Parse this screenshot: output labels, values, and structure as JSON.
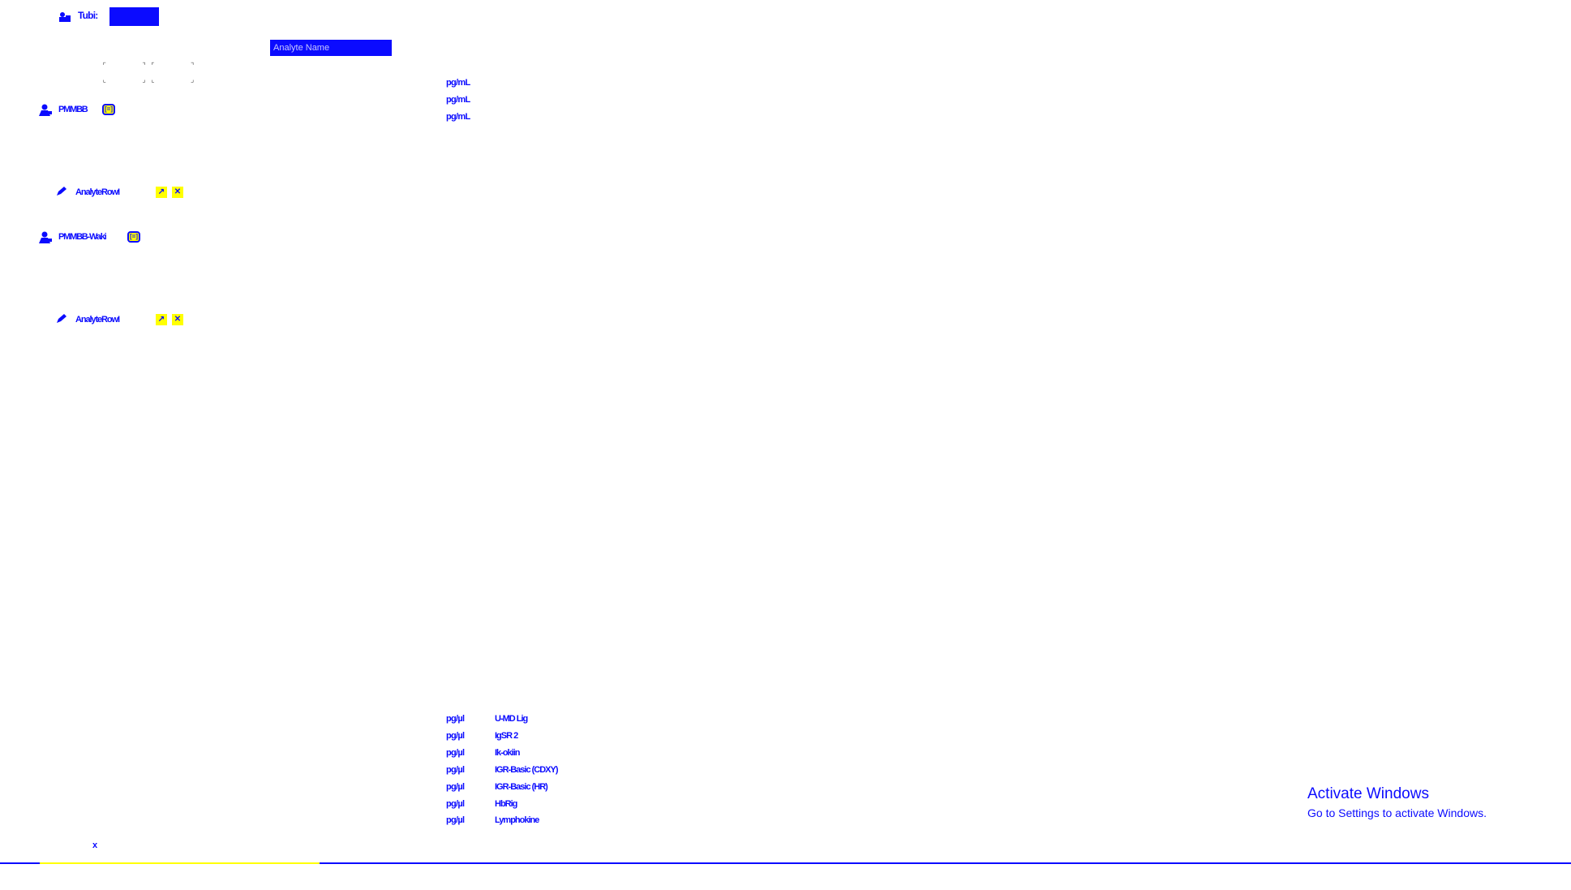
{
  "header": {
    "user_icon": "users-icon",
    "label": "Tubi:",
    "accent_color": "#0b0bff"
  },
  "search": {
    "placeholder": "Analyte Name"
  },
  "top_units": [
    "pg/mL",
    "pg/mL",
    "pg/mL"
  ],
  "groups": [
    {
      "person_label": "PMMBB",
      "toggle_label": "[=]",
      "analyte_label": "AnalyteRowI",
      "open_label": "↗",
      "close_label": "✕"
    },
    {
      "person_label": "PMMBB-Waki",
      "toggle_label": "[=]",
      "analyte_label": "AnalyteRowI",
      "open_label": "↗",
      "close_label": "✕"
    }
  ],
  "bottom_list": [
    {
      "unit": "pg/µl",
      "name": "U-MD Lig"
    },
    {
      "unit": "pg/µl",
      "name": "IgSR 2"
    },
    {
      "unit": "pg/µl",
      "name": "Ik-okiin"
    },
    {
      "unit": "pg/µl",
      "name": "IGR-Basic (CDXY)"
    },
    {
      "unit": "pg/µl",
      "name": "IGR-Basic (HR)"
    },
    {
      "unit": "pg/µl",
      "name": "HbRig"
    },
    {
      "unit": "pg/µl",
      "name": "Lymphokine"
    }
  ],
  "footer": {
    "close_glyph": "x",
    "highlight_color": "#ffff00"
  },
  "watermark": {
    "title": "Activate Windows",
    "subtitle": "Go to Settings to activate Windows."
  }
}
